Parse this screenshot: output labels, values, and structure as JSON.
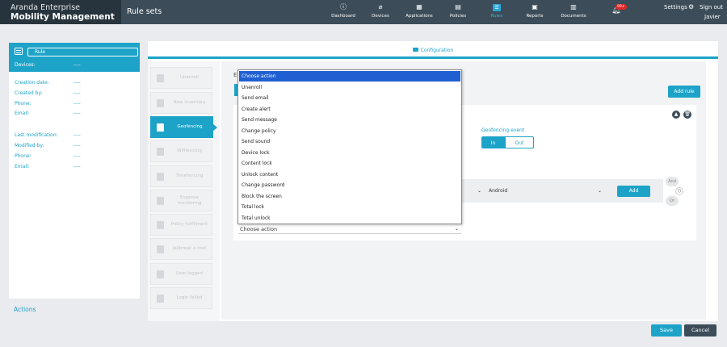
{
  "header": {
    "brand_line1": "Aranda Enterprise",
    "brand_line2": "Mobility Management",
    "app_title": "Rule sets",
    "nav": [
      {
        "label": "Dashboard",
        "icon": "info-icon"
      },
      {
        "label": "Devices",
        "icon": "devices-icon"
      },
      {
        "label": "Applications",
        "icon": "grid-icon"
      },
      {
        "label": "Policies",
        "icon": "policies-icon"
      },
      {
        "label": "Rules",
        "icon": "rules-icon",
        "active": true
      },
      {
        "label": "Reports",
        "icon": "reports-icon"
      },
      {
        "label": "Documents",
        "icon": "documents-icon"
      }
    ],
    "notifications_badge": "99+",
    "settings": "Settings",
    "sign_out": "Sign out",
    "user": "Javier"
  },
  "left_panel": {
    "rule_name": "Rule",
    "devices_label": "Devices:",
    "devices_value": "----",
    "creation_date_label": "Creation date:",
    "creation_date_value": "----",
    "created_by_label": "Created by:",
    "created_by_value": "----",
    "phone1_label": "Phone:",
    "phone1_value": "----",
    "email1_label": "Email:",
    "email1_value": "----",
    "last_mod_label": "Last modification:",
    "last_mod_value": "----",
    "modified_by_label": "Modified by:",
    "modified_by_value": "----",
    "phone2_label": "Phone:",
    "phone2_value": "----",
    "email2_label": "Email:",
    "email2_value": "----",
    "actions_link": "Actions"
  },
  "config": {
    "title": "Configuration",
    "triggers": [
      {
        "label": "Unenroll"
      },
      {
        "label": "New inventory"
      },
      {
        "label": "Geofencing",
        "active": true
      },
      {
        "label": "Wififencing"
      },
      {
        "label": "Timefencing"
      },
      {
        "label": "Expense monitoring"
      },
      {
        "label": "Policy fulfillment"
      },
      {
        "label": "Jailbreak o root"
      },
      {
        "label": "User logged"
      },
      {
        "label": "Login failed"
      }
    ],
    "e_label": "E",
    "add_rule": "Add rule",
    "geofencing_event_label": "Geofencing event",
    "event_in": "In",
    "event_out": "Out",
    "platform_value": "Android",
    "add_condition": "Add",
    "and": "And",
    "paren": "()",
    "or": "Or",
    "action_select": "Choose action"
  },
  "dropdown": {
    "options": [
      "Choose action",
      "Unenroll",
      "Send email",
      "Create alert",
      "Send message",
      "Change policy",
      "Send sound",
      "Device lock",
      "Content lock",
      "Unlock content",
      "Change password",
      "Block the screen",
      "Total lock",
      "Total unlock"
    ],
    "selected_index": 0
  },
  "footer": {
    "save": "Save",
    "cancel": "Cancel"
  },
  "colors": {
    "accent": "#1da3c8",
    "topbar": "#3c4d59",
    "selected_option": "#1f5fd1"
  }
}
